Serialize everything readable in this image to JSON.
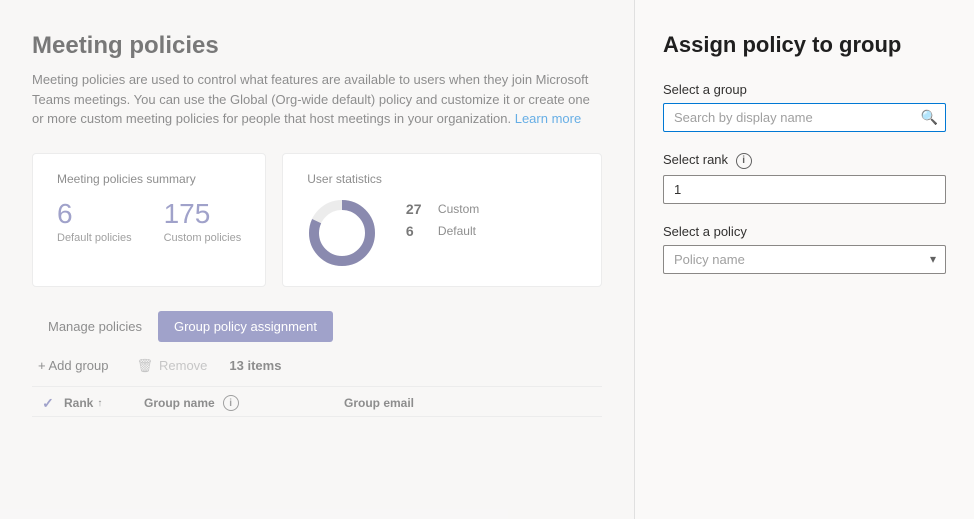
{
  "page": {
    "title": "Meeting policies",
    "description": "Meeting policies are used to control what features are available to users when they join Microsoft Teams meetings. You can use the Global (Org-wide default) policy and customize it or create one or more custom meeting policies for people that host meetings in your organization.",
    "learn_more": "Learn more"
  },
  "summary_card": {
    "title": "Meeting policies summary",
    "default_count": "6",
    "default_label": "Default policies",
    "custom_count": "175",
    "custom_label": "Custom policies"
  },
  "user_statistics": {
    "title": "User statistics",
    "custom_count": "27",
    "custom_label": "Custom",
    "default_count": "6",
    "default_label": "Default"
  },
  "tabs": [
    {
      "id": "manage",
      "label": "Manage policies"
    },
    {
      "id": "group",
      "label": "Group policy assignment"
    }
  ],
  "toolbar": {
    "add_label": "+ Add group",
    "remove_label": "Remove",
    "items_count": "13 items"
  },
  "table": {
    "columns": [
      {
        "id": "rank",
        "label": "Rank"
      },
      {
        "id": "group-name",
        "label": "Group name"
      },
      {
        "id": "group-email",
        "label": "Group email"
      }
    ]
  },
  "right_panel": {
    "title": "Assign policy to group",
    "select_group_label": "Select a group",
    "search_placeholder": "Search by display name",
    "select_rank_label": "Select rank",
    "rank_value": "1",
    "select_policy_label": "Select a policy",
    "policy_placeholder": "Policy name"
  },
  "icons": {
    "search": "🔍",
    "info": "i",
    "chevron_down": "▾",
    "sort_asc": "↑",
    "check": "✓",
    "delete": "🗑"
  }
}
